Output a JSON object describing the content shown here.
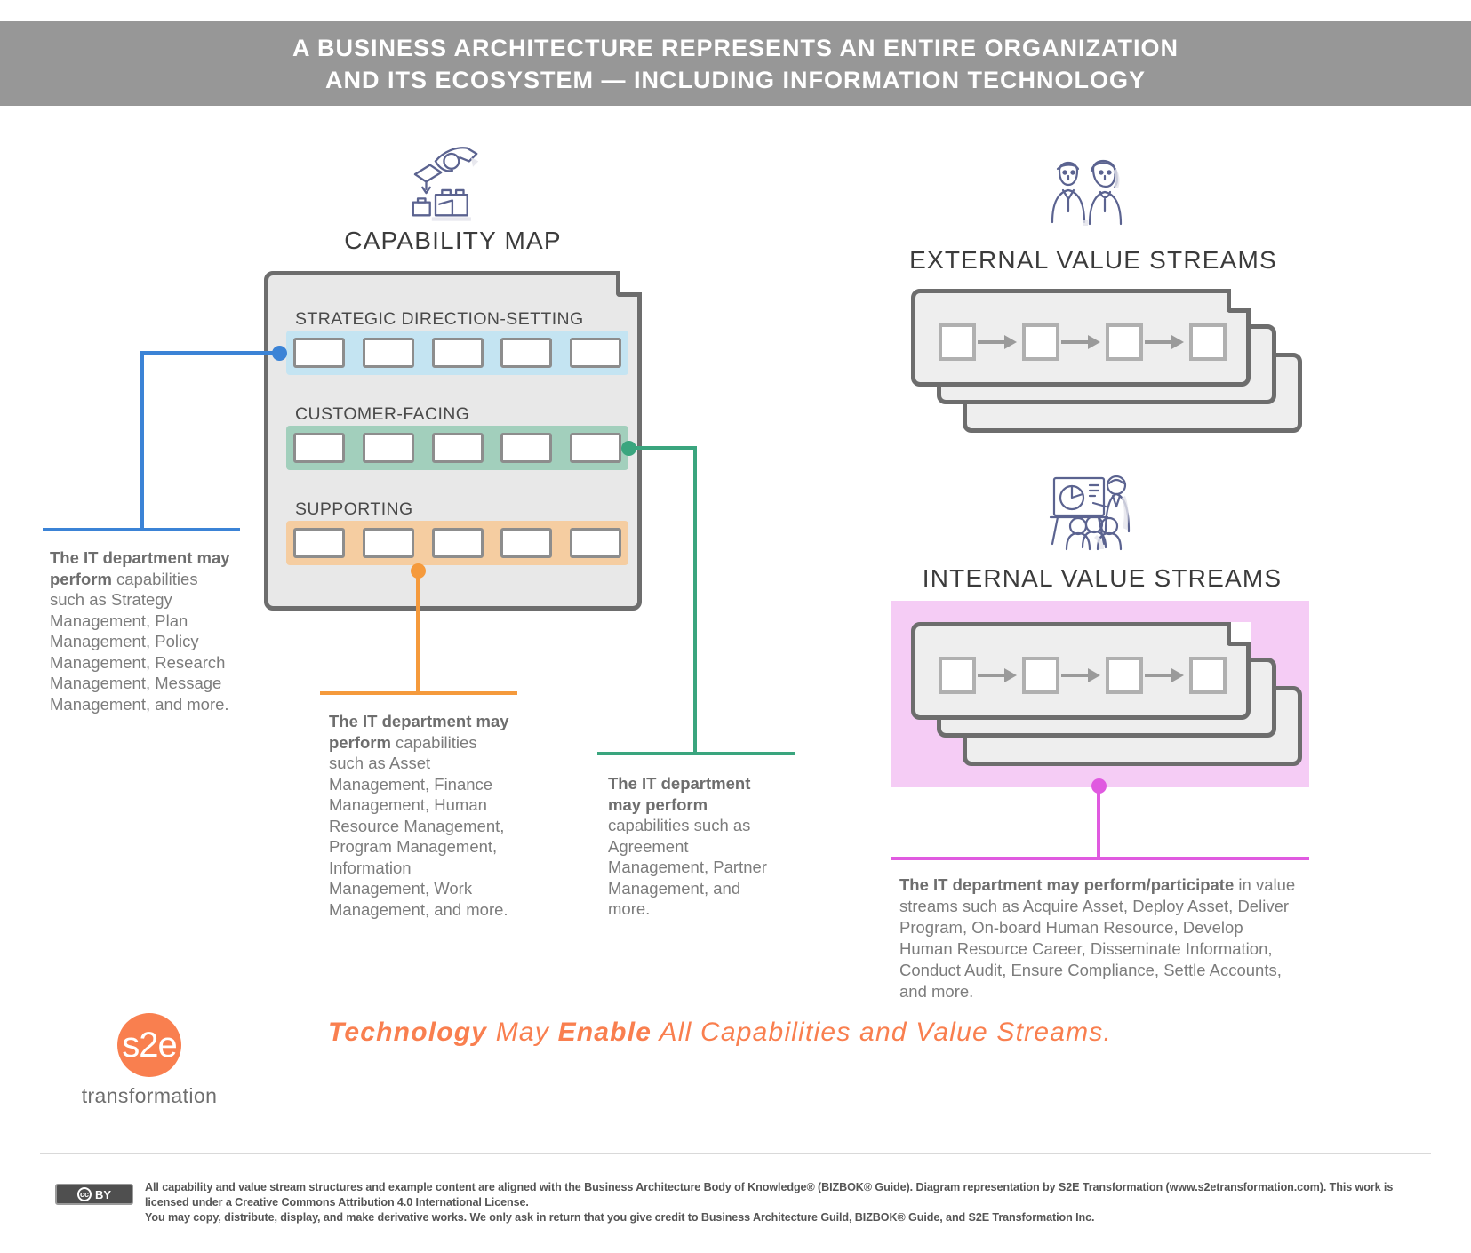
{
  "header": {
    "line1": "A BUSINESS ARCHITECTURE REPRESENTS AN ENTIRE ORGANIZATION",
    "line2": "AND ITS ECOSYSTEM — INCLUDING INFORMATION TECHNOLOGY",
    "background_color": "#979797",
    "text_color": "#ffffff"
  },
  "capability_map": {
    "icon": "hand-placing-block-icon",
    "title": "CAPABILITY MAP",
    "rows": [
      {
        "label": "STRATEGIC DIRECTION-SETTING",
        "band_color": "#c4e4f2",
        "boxes": 5
      },
      {
        "label": "CUSTOMER-FACING",
        "band_color": "#a2cfbc",
        "boxes": 5
      },
      {
        "label": "SUPPORTING",
        "band_color": "#f5cda1",
        "boxes": 5
      }
    ]
  },
  "external_value_streams": {
    "icon": "two-people-icon",
    "title": "EXTERNAL VALUE STREAMS",
    "cards": 3,
    "nodes_per_card": 4
  },
  "internal_value_streams": {
    "icon": "presenter-with-audience-icon",
    "title": "INTERNAL VALUE STREAMS",
    "cards": 3,
    "nodes_per_card": 4,
    "highlight_color": "#f5ccf5"
  },
  "callouts": [
    {
      "id": "strategic",
      "color": "#3b83d6",
      "bold": "The IT department may perform",
      "rest": " capabilities such as Strategy Management, Plan Management, Policy Management, Research Management, Message Management, and more."
    },
    {
      "id": "supporting",
      "color": "#f59a3c",
      "bold": "The IT department may perform",
      "rest": " capabilities such as Asset Management, Finance Management, Human Resource Management, Program Management, Information Management, Work Management, and more."
    },
    {
      "id": "customer-facing",
      "color": "#3aa57e",
      "bold": "The IT department may perform",
      "rest": " capabilities such as Agreement Management, Partner Management, and more."
    },
    {
      "id": "internal-value-streams",
      "color": "#e05ae0",
      "bold": "The IT department may perform/participate",
      "rest": " in value streams such as Acquire Asset, Deploy Asset, Deliver Program, On-board Human Resource, Develop Human Resource Career, Disseminate Information, Conduct Audit, Ensure Compliance, Settle Accounts, and more."
    }
  ],
  "tagline": {
    "word1": "Technology",
    "word2": " May ",
    "word3": "Enable",
    "word4": " All Capabilities and Value Streams.",
    "color": "#f97f4f"
  },
  "logo": {
    "mark": "s2e",
    "word": "transformation",
    "color": "#f97f4f"
  },
  "footer": {
    "badge_cc": "cc",
    "badge_by": "BY",
    "line1": "All capability and value stream structures and example content are aligned with the Business Architecture Body of Knowledge® (BIZBOK® Guide). Diagram representation by S2E Transformation (www.s2etransformation.com). This work is licensed under a Creative Commons Attribution 4.0 International License.",
    "line2": "You may copy, distribute, display, and make derivative works. We only ask in return that you give credit to Business Architecture Guild, BIZBOK® Guide, and S2E Transformation Inc."
  }
}
